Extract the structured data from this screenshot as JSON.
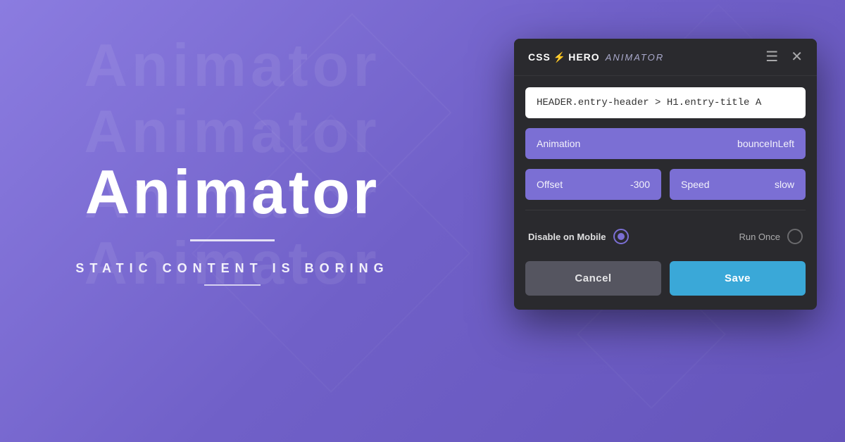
{
  "background": {
    "gradient_start": "#8b7ce0",
    "gradient_end": "#6555bb"
  },
  "left": {
    "watermark_lines": [
      "Animator",
      "Animator",
      "Animator"
    ],
    "main_title": "Animator",
    "subtitle": "STATIC CONTENT IS BORING"
  },
  "panel": {
    "logo": {
      "css": "CSS",
      "bolt": "⚡",
      "hero": "HERO",
      "animator": "ANIMATOR"
    },
    "selector": "HEADER.entry-header > H1.entry-title A",
    "animation_label": "Animation",
    "animation_value": "bounceInLeft",
    "offset_label": "Offset",
    "offset_value": "-300",
    "speed_label": "Speed",
    "speed_value": "slow",
    "disable_mobile_label": "Disable on Mobile",
    "run_once_label": "Run Once",
    "cancel_label": "Cancel",
    "save_label": "Save"
  },
  "colors": {
    "purple": "#7b6fd4",
    "panel_bg": "#2a2a2e",
    "teal": "#3aa8d8",
    "gray_btn": "#555560"
  }
}
